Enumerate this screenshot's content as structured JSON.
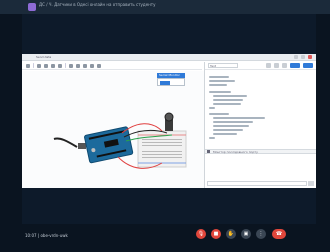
{
  "meeting": {
    "title": "ДС / Ч. Датчики в Одесі онлайн на отправить студенту",
    "time": "10:07",
    "code": "obe-vrdn-uwk"
  },
  "app": {
    "window_title": "Send data",
    "board_dropdown": "Text",
    "monitor_title": "Serial Monitor",
    "serial_label": "Монітор послідовного порту"
  },
  "controls": [
    {
      "name": "mic-off-icon",
      "glyph": "🎙"
    },
    {
      "name": "camera-off-icon",
      "glyph": "■"
    },
    {
      "name": "raise-hand-icon",
      "glyph": "✋"
    },
    {
      "name": "present-icon",
      "glyph": "▣"
    },
    {
      "name": "more-icon",
      "glyph": "⋮"
    },
    {
      "name": "leave-call-icon",
      "glyph": "☎"
    }
  ],
  "colors": {
    "accent": "#2f7ad8",
    "end_call": "#e0463b",
    "background": "#0d1a2a"
  }
}
